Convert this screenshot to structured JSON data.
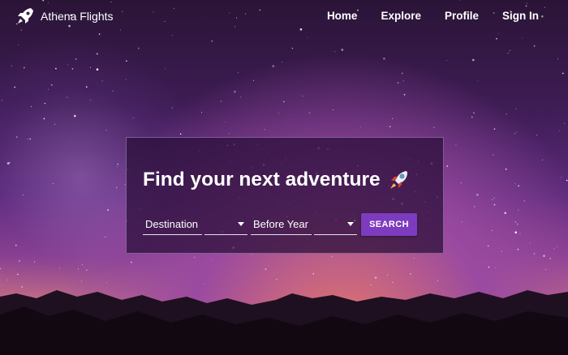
{
  "brand": {
    "name": "Athena Flights",
    "icon": "rocket-icon"
  },
  "nav": {
    "items": [
      {
        "label": "Home"
      },
      {
        "label": "Explore"
      },
      {
        "label": "Profile"
      },
      {
        "label": "Sign In"
      }
    ]
  },
  "search": {
    "headline": "Find your next adventure",
    "headline_icon": "rocket-emoji-icon",
    "destination_label": "Destination",
    "destination_value": "",
    "year_label": "Before Year",
    "year_value": "",
    "button_label": "SEARCH"
  },
  "colors": {
    "accent": "#7d3bbf",
    "card_background": "#280e38",
    "text": "#ffffff"
  }
}
